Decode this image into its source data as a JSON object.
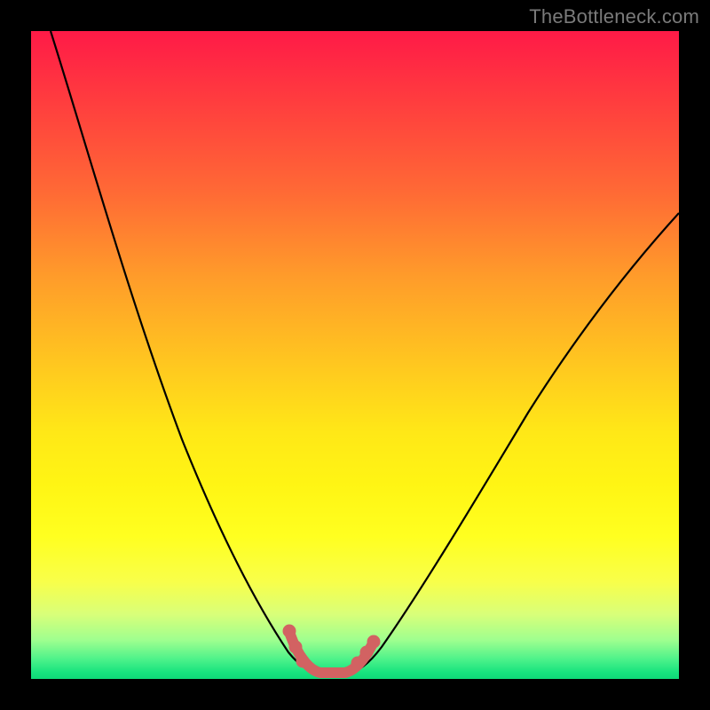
{
  "watermark": "TheBottleneck.com",
  "colors": {
    "background": "#000000",
    "curve_stroke": "#000000",
    "bump_stroke": "#d26262",
    "gradient_stops": [
      "#ff1a47",
      "#ff9c2a",
      "#fff514",
      "#17e37e"
    ]
  },
  "chart_data": {
    "type": "line",
    "title": "",
    "xlabel": "",
    "ylabel": "",
    "xlim": [
      0,
      100
    ],
    "ylim": [
      0,
      100
    ],
    "series": [
      {
        "name": "bottleneck-v-curve",
        "note": "Approximate V-shaped curve; values estimated from pixels (unlabeled axes). Minimum (bottom plateau) around x≈44–49%, y≈1%.",
        "x": [
          3,
          6,
          10,
          14,
          18,
          22,
          26,
          30,
          34,
          36,
          38,
          40,
          42,
          44,
          46,
          48,
          49,
          51,
          54,
          58,
          63,
          68,
          74,
          80,
          86,
          92,
          100
        ],
        "y": [
          100,
          90,
          78,
          66,
          55,
          45,
          36,
          28,
          21,
          17,
          13,
          9,
          5,
          2,
          1,
          1,
          2,
          4,
          8,
          14,
          21,
          29,
          38,
          47,
          56,
          63,
          72
        ]
      },
      {
        "name": "bottom-bump-highlight",
        "note": "Short salmon-colored segment with dots near the curve minimum.",
        "x": [
          40,
          42,
          43,
          44,
          46,
          48,
          49,
          50
        ],
        "y": [
          7,
          3,
          2,
          1,
          1,
          1,
          2,
          4
        ]
      }
    ]
  }
}
